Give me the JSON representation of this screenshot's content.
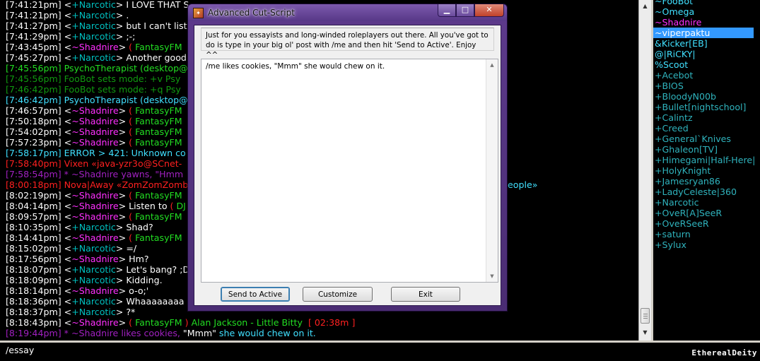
{
  "colors": {
    "white": "#ffffff",
    "cyan_nick": "#00c0c0",
    "magenta_nick": "#ff30ff",
    "green": "#22dd22",
    "dark_green": "#109910",
    "bright_cyan": "#40e0ff",
    "red": "#ff2020",
    "purple": "#a020c0",
    "nick_default": "#2fb3bd",
    "nick_light": "#40e0ff",
    "selection": "#3399ff"
  },
  "chat": {
    "lines": [
      {
        "segments": [
          {
            "t": "[7:41:21pm] <",
            "c": "#ffffff"
          },
          {
            "t": "+Narcotic",
            "c": "#00c0c0"
          },
          {
            "t": "> I LOVE THAT S",
            "c": "#ffffff"
          }
        ]
      },
      {
        "segments": [
          {
            "t": "[7:41:21pm] <",
            "c": "#ffffff"
          },
          {
            "t": "+Narcotic",
            "c": "#00c0c0"
          },
          {
            "t": "> .",
            "c": "#ffffff"
          }
        ]
      },
      {
        "segments": [
          {
            "t": "[7:41:27pm] <",
            "c": "#ffffff"
          },
          {
            "t": "+Narcotic",
            "c": "#00c0c0"
          },
          {
            "t": "> but I can't list",
            "c": "#ffffff"
          }
        ]
      },
      {
        "segments": [
          {
            "t": "[7:41:29pm] <",
            "c": "#ffffff"
          },
          {
            "t": "+Narcotic",
            "c": "#00c0c0"
          },
          {
            "t": "> ;-;",
            "c": "#ffffff"
          }
        ]
      },
      {
        "segments": [
          {
            "t": "[7:43:45pm] <",
            "c": "#ffffff"
          },
          {
            "t": "~Shadnire",
            "c": "#ff30ff"
          },
          {
            "t": "> ",
            "c": "#ffffff"
          },
          {
            "t": "( ",
            "c": "#ff2020"
          },
          {
            "t": "FantasyFM",
            "c": "#22dd22"
          }
        ]
      },
      {
        "segments": [
          {
            "t": "[7:45:27pm] <",
            "c": "#ffffff"
          },
          {
            "t": "+Narcotic",
            "c": "#00c0c0"
          },
          {
            "t": "> Another good",
            "c": "#ffffff"
          }
        ]
      },
      {
        "segments": [
          {
            "t": "[7:45:56pm] PsychoTherapist (desktop@",
            "c": "#22dd22"
          }
        ]
      },
      {
        "segments": [
          {
            "t": "[7:45:56pm] FooBot sets mode: +v Psy",
            "c": "#109910"
          }
        ]
      },
      {
        "segments": [
          {
            "t": "[7:46:42pm] FooBot sets mode: +q Psy",
            "c": "#109910"
          }
        ]
      },
      {
        "segments": [
          {
            "t": "[7:46:42pm] PsychoTherapist (desktop@",
            "c": "#40e0ff"
          }
        ]
      },
      {
        "segments": [
          {
            "t": "[7:46:57pm] <",
            "c": "#ffffff"
          },
          {
            "t": "~Shadnire",
            "c": "#ff30ff"
          },
          {
            "t": "> ",
            "c": "#ffffff"
          },
          {
            "t": "( ",
            "c": "#ff2020"
          },
          {
            "t": "FantasyFM",
            "c": "#22dd22"
          }
        ]
      },
      {
        "segments": [
          {
            "t": "[7:50:18pm] <",
            "c": "#ffffff"
          },
          {
            "t": "~Shadnire",
            "c": "#ff30ff"
          },
          {
            "t": "> ",
            "c": "#ffffff"
          },
          {
            "t": "( ",
            "c": "#ff2020"
          },
          {
            "t": "FantasyFM",
            "c": "#22dd22"
          }
        ]
      },
      {
        "segments": [
          {
            "t": "[7:54:02pm] <",
            "c": "#ffffff"
          },
          {
            "t": "~Shadnire",
            "c": "#ff30ff"
          },
          {
            "t": "> ",
            "c": "#ffffff"
          },
          {
            "t": "( ",
            "c": "#ff2020"
          },
          {
            "t": "FantasyFM",
            "c": "#22dd22"
          }
        ]
      },
      {
        "segments": [
          {
            "t": "[7:57:23pm] <",
            "c": "#ffffff"
          },
          {
            "t": "~Shadnire",
            "c": "#ff30ff"
          },
          {
            "t": "> ",
            "c": "#ffffff"
          },
          {
            "t": "( ",
            "c": "#ff2020"
          },
          {
            "t": "FantasyFM",
            "c": "#22dd22"
          }
        ]
      },
      {
        "segments": [
          {
            "t": "[7:58:17pm] ERROR ",
            "c": "#40e0ff"
          },
          {
            "t": "> 421: Unknown co",
            "c": "#40e0ff"
          }
        ]
      },
      {
        "segments": [
          {
            "t": "[7:58:40pm] Vixen «java-yzr3o@SCnet-",
            "c": "#ff2020"
          }
        ]
      },
      {
        "segments": [
          {
            "t": "[7:58:54pm] * ~Shadnire yawns, \"Hmm",
            "c": "#a020c0"
          }
        ]
      },
      {
        "segments": [
          {
            "t": "[8:00:18pm] Nova|Away «ZomZomZomb",
            "c": "#ff2020"
          }
        ]
      },
      {
        "segments": [
          {
            "t": "[8:02:19pm] <",
            "c": "#ffffff"
          },
          {
            "t": "~Shadnire",
            "c": "#ff30ff"
          },
          {
            "t": "> ",
            "c": "#ffffff"
          },
          {
            "t": "( ",
            "c": "#ff2020"
          },
          {
            "t": "FantasyFM",
            "c": "#22dd22"
          }
        ]
      },
      {
        "segments": [
          {
            "t": "[8:04:14pm] <",
            "c": "#ffffff"
          },
          {
            "t": "~Shadnire",
            "c": "#ff30ff"
          },
          {
            "t": "> Listen to ",
            "c": "#ffffff"
          },
          {
            "t": "( ",
            "c": "#ff2020"
          },
          {
            "t": "DJ",
            "c": "#22dd22"
          }
        ]
      },
      {
        "segments": [
          {
            "t": "[8:09:57pm] <",
            "c": "#ffffff"
          },
          {
            "t": "~Shadnire",
            "c": "#ff30ff"
          },
          {
            "t": "> ",
            "c": "#ffffff"
          },
          {
            "t": "( ",
            "c": "#ff2020"
          },
          {
            "t": "FantasyFM",
            "c": "#22dd22"
          }
        ]
      },
      {
        "segments": [
          {
            "t": "[8:10:35pm] <",
            "c": "#ffffff"
          },
          {
            "t": "+Narcotic",
            "c": "#00c0c0"
          },
          {
            "t": "> Shad?",
            "c": "#ffffff"
          }
        ]
      },
      {
        "segments": [
          {
            "t": "[8:14:41pm] <",
            "c": "#ffffff"
          },
          {
            "t": "~Shadnire",
            "c": "#ff30ff"
          },
          {
            "t": "> ",
            "c": "#ffffff"
          },
          {
            "t": "( ",
            "c": "#ff2020"
          },
          {
            "t": "FantasyFM",
            "c": "#22dd22"
          }
        ]
      },
      {
        "segments": [
          {
            "t": "[8:15:02pm] <",
            "c": "#ffffff"
          },
          {
            "t": "+Narcotic",
            "c": "#00c0c0"
          },
          {
            "t": "> =/",
            "c": "#ffffff"
          }
        ]
      },
      {
        "segments": [
          {
            "t": "[8:17:56pm] <",
            "c": "#ffffff"
          },
          {
            "t": "~Shadnire",
            "c": "#ff30ff"
          },
          {
            "t": "> Hm?",
            "c": "#ffffff"
          }
        ]
      },
      {
        "segments": [
          {
            "t": "[8:18:07pm] <",
            "c": "#ffffff"
          },
          {
            "t": "+Narcotic",
            "c": "#00c0c0"
          },
          {
            "t": "> Let's bang? ;D",
            "c": "#ffffff"
          }
        ]
      },
      {
        "segments": [
          {
            "t": "[8:18:09pm] <",
            "c": "#ffffff"
          },
          {
            "t": "+Narcotic",
            "c": "#00c0c0"
          },
          {
            "t": "> Kidding.",
            "c": "#ffffff"
          }
        ]
      },
      {
        "segments": [
          {
            "t": "[8:18:14pm] <",
            "c": "#ffffff"
          },
          {
            "t": "~Shadnire",
            "c": "#ff30ff"
          },
          {
            "t": "> o-o;'",
            "c": "#ffffff"
          }
        ]
      },
      {
        "segments": [
          {
            "t": "[8:18:36pm] <",
            "c": "#ffffff"
          },
          {
            "t": "+Narcotic",
            "c": "#00c0c0"
          },
          {
            "t": "> Whaaaaaaaa",
            "c": "#ffffff"
          }
        ]
      },
      {
        "segments": [
          {
            "t": "[8:18:37pm] <",
            "c": "#ffffff"
          },
          {
            "t": "+Narcotic",
            "c": "#00c0c0"
          },
          {
            "t": "> ?*",
            "c": "#ffffff"
          }
        ]
      },
      {
        "segments": [
          {
            "t": "[8:18:43pm] <",
            "c": "#ffffff"
          },
          {
            "t": "~Shadnire",
            "c": "#ff30ff"
          },
          {
            "t": "> ",
            "c": "#ffffff"
          },
          {
            "t": "( ",
            "c": "#ff2020"
          },
          {
            "t": "FantasyFM",
            "c": "#22dd22"
          },
          {
            "t": " ) ",
            "c": "#ff2020"
          },
          {
            "t": "Alan Jackson - Little Bitty",
            "c": "#22dd22"
          },
          {
            "t": "  [ ",
            "c": "#ff2020"
          },
          {
            "t": "02:38m",
            "c": "#ff2020"
          },
          {
            "t": " ]",
            "c": "#ff2020"
          }
        ]
      },
      {
        "segments": [
          {
            "t": "[8:19:44pm] * ~Shadnire likes cookies, ",
            "c": "#a020c0"
          },
          {
            "t": "\"Mmm\"",
            "c": "#ffffff"
          },
          {
            "t": " she would chew on it.",
            "c": "#40e0ff"
          }
        ]
      }
    ],
    "overflow_text": "eople»"
  },
  "nicklist": {
    "items": [
      {
        "label": "~FooBot",
        "color": "#40e0ff",
        "selected": false
      },
      {
        "label": "~Omega",
        "color": "#40e0ff",
        "selected": false
      },
      {
        "label": "~Shadnire",
        "color": "#ff30ff",
        "selected": false
      },
      {
        "label": "~viperpaktu",
        "color": "#ffffff",
        "selected": true
      },
      {
        "label": "&Kicker[EB]",
        "color": "#40e0ff",
        "selected": false
      },
      {
        "label": "@|RiCKY|",
        "color": "#40e0ff",
        "selected": false
      },
      {
        "label": "%Scoot",
        "color": "#40e0ff",
        "selected": false
      },
      {
        "label": "+Acebot",
        "color": "#2fb3bd",
        "selected": false
      },
      {
        "label": "+BIOS",
        "color": "#2fb3bd",
        "selected": false
      },
      {
        "label": "+BloodyN00b",
        "color": "#2fb3bd",
        "selected": false
      },
      {
        "label": "+Bullet[nightschool]",
        "color": "#2fb3bd",
        "selected": false
      },
      {
        "label": "+Calintz",
        "color": "#2fb3bd",
        "selected": false
      },
      {
        "label": "+Creed",
        "color": "#2fb3bd",
        "selected": false
      },
      {
        "label": "+General`Knives",
        "color": "#2fb3bd",
        "selected": false
      },
      {
        "label": "+Ghaleon[TV]",
        "color": "#2fb3bd",
        "selected": false
      },
      {
        "label": "+Himegami|Half-Here|",
        "color": "#2fb3bd",
        "selected": false
      },
      {
        "label": "+HolyKnight",
        "color": "#2fb3bd",
        "selected": false
      },
      {
        "label": "+Jamesryan86",
        "color": "#2fb3bd",
        "selected": false
      },
      {
        "label": "+LadyCeleste|360",
        "color": "#2fb3bd",
        "selected": false
      },
      {
        "label": "+Narcotic",
        "color": "#2fb3bd",
        "selected": false
      },
      {
        "label": "+OveR[A]SeeR",
        "color": "#2fb3bd",
        "selected": false
      },
      {
        "label": "+OveRSeeR",
        "color": "#2fb3bd",
        "selected": false
      },
      {
        "label": "+saturn",
        "color": "#2fb3bd",
        "selected": false
      },
      {
        "label": "+Sylux",
        "color": "#2fb3bd",
        "selected": false
      }
    ]
  },
  "input": {
    "value": "/essay"
  },
  "watermark": "EtherealDeity",
  "dialog": {
    "title": "Advanced Cut-Script",
    "icon": "app-icon",
    "description": "Just for you essayists and long-winded roleplayers out there. All you've got to do is type in your big ol' post with /me and then hit 'Send to Active'. Enjoy ^^",
    "text": "/me likes cookies, \"Mmm\" she would chew on it.",
    "buttons": {
      "send": "Send to Active",
      "customize": "Customize",
      "exit": "Exit"
    },
    "window_buttons": {
      "minimize": "▁",
      "maximize": "□",
      "close": "✕"
    }
  }
}
